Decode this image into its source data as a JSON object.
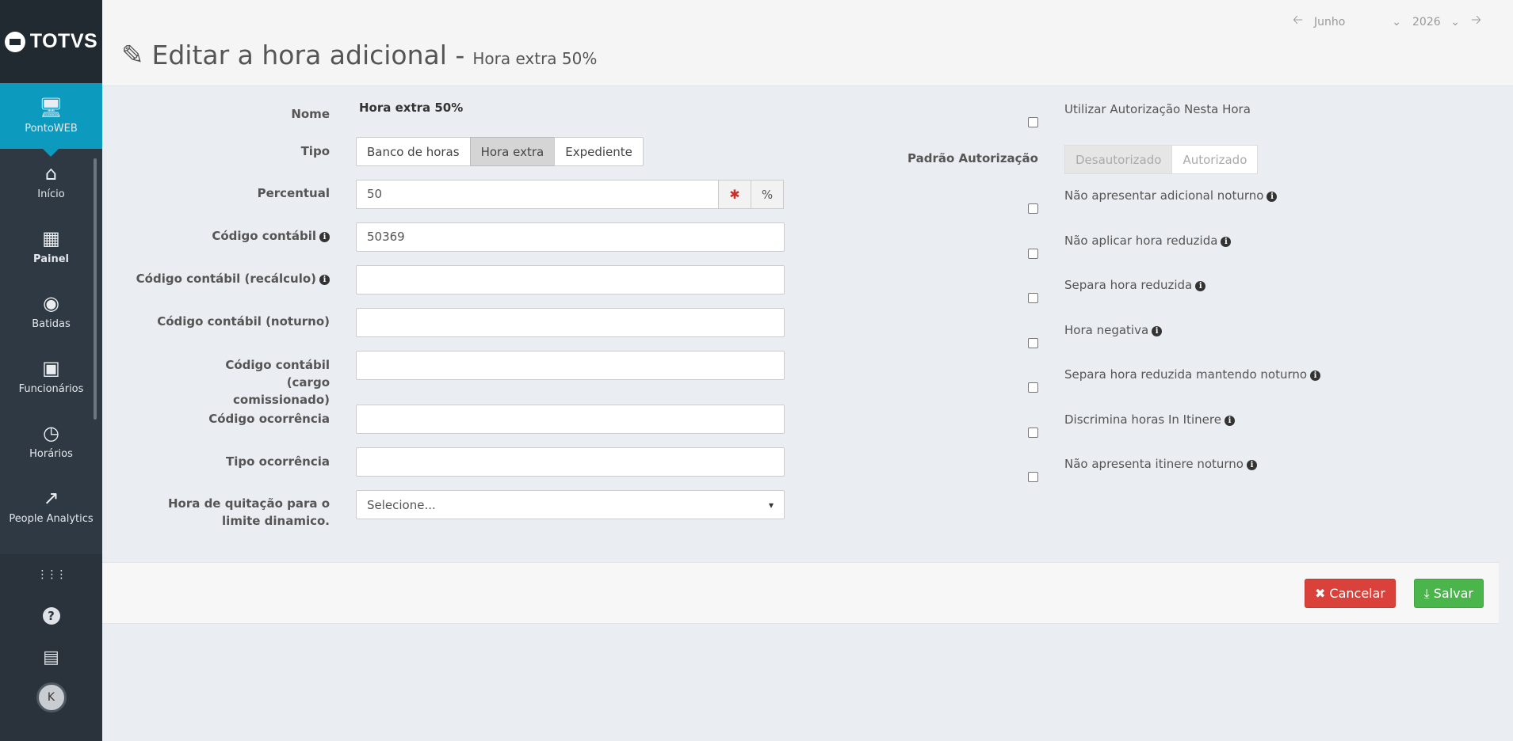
{
  "brand": {
    "logo_text": "TOTVS"
  },
  "sidebar": {
    "items": [
      {
        "label": "PontoWEB",
        "icon": "monitor-icon",
        "glyph": "🖥"
      },
      {
        "label": "Início",
        "icon": "home-icon",
        "glyph": "⌂"
      },
      {
        "label": "Painel",
        "icon": "dashboard-icon",
        "glyph": "▦"
      },
      {
        "label": "Batidas",
        "icon": "fingerprint-icon",
        "glyph": "◉"
      },
      {
        "label": "Funcionários",
        "icon": "badge-icon",
        "glyph": "▣"
      },
      {
        "label": "Horários",
        "icon": "clock-icon",
        "glyph": "◷"
      },
      {
        "label": "People Analytics",
        "icon": "trend-icon",
        "glyph": "↗"
      }
    ],
    "bottom": {
      "apps_glyph": "⋮⋮⋮",
      "help_glyph": "?",
      "company_glyph": "▤",
      "avatar_initial": "K"
    }
  },
  "header": {
    "title": "Editar a hora adicional -",
    "subtitle": "Hora extra 50%",
    "month": "Junho",
    "year": "2026"
  },
  "form": {
    "nome_label": "Nome",
    "nome_value": "Hora extra 50%",
    "tipo_label": "Tipo",
    "tipo_options": [
      "Banco de horas",
      "Hora extra",
      "Expediente"
    ],
    "percentual_label": "Percentual",
    "percentual_value": "50",
    "percentual_suffix": "%",
    "codigo_contabil_label": "Código contábil",
    "codigo_contabil_value": "50369",
    "codigo_recalculo_label": "Código contábil (recálculo)",
    "codigo_noturno_label": "Código contábil (noturno)",
    "codigo_cargo_label": "Código contábil (cargo comissionado)",
    "codigo_ocorrencia_label": "Código ocorrência",
    "tipo_ocorrencia_label": "Tipo ocorrência",
    "hora_quitacao_label": "Hora de quitação para o limite dinamico.",
    "hora_quitacao_value": "Selecione..."
  },
  "right": {
    "utilizar_autorizacao": "Utilizar Autorização Nesta Hora",
    "padrao_autorizacao_label": "Padrão Autorização",
    "autorizacao_options": [
      "Desautorizado",
      "Autorizado"
    ],
    "nao_adicional_noturno": "Não apresentar adicional noturno",
    "nao_hora_reduzida": "Não aplicar hora reduzida",
    "separa_hora_reduzida": "Separa hora reduzida",
    "hora_negativa": "Hora negativa",
    "separa_reduzida_noturno": "Separa hora reduzida mantendo noturno",
    "discrimina_itinere": "Discrimina horas In Itinere",
    "nao_itinere_noturno": "Não apresenta itinere noturno"
  },
  "footer": {
    "cancel_label": "Cancelar",
    "save_label": "Salvar"
  },
  "colors": {
    "active_nav": "#0c9abe",
    "cancel": "#d9413a",
    "save": "#49b54b"
  }
}
